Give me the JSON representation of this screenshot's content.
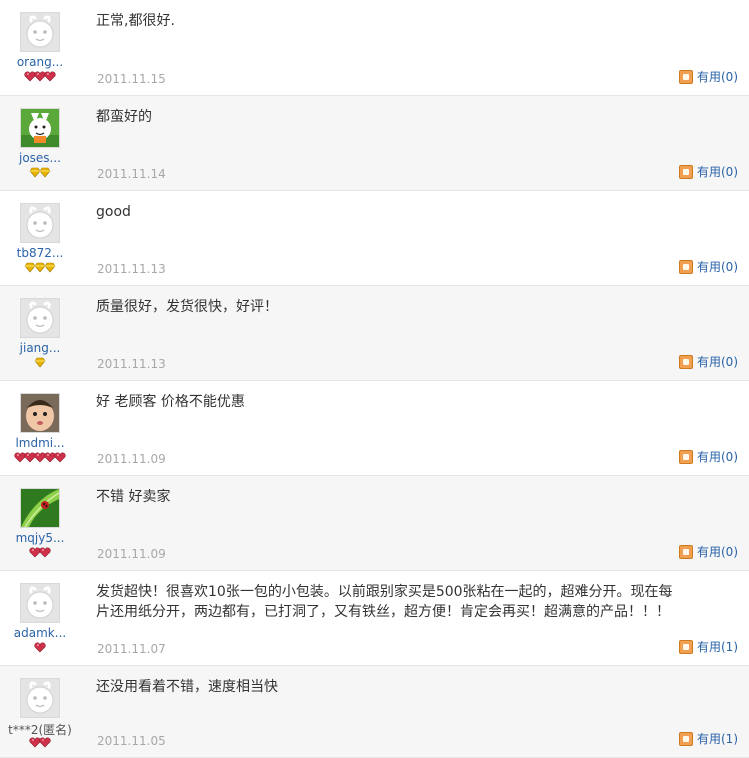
{
  "useful_prefix": "有用",
  "reviews": [
    {
      "user": "orang...",
      "rank": "heart",
      "rank_count": 3,
      "avatar": "default",
      "comment": "正常,都很好.",
      "date": "2011.11.15",
      "useful": "有用(0)"
    },
    {
      "user": "joses...",
      "rank": "diamond",
      "rank_count": 2,
      "avatar": "cartoon",
      "comment": "都蛮好的",
      "date": "2011.11.14",
      "useful": "有用(0)"
    },
    {
      "user": "tb872...",
      "rank": "diamond",
      "rank_count": 3,
      "avatar": "default",
      "comment": "good",
      "date": "2011.11.13",
      "useful": "有用(0)"
    },
    {
      "user": "jiang...",
      "rank": "diamond",
      "rank_count": 1,
      "avatar": "default",
      "comment": "质量很好，发货很快，好评！",
      "date": "2011.11.13",
      "useful": "有用(0)"
    },
    {
      "user": "lmdmi...",
      "rank": "heart",
      "rank_count": 5,
      "avatar": "baby",
      "comment": "好 老顾客 价格不能优惠",
      "date": "2011.11.09",
      "useful": "有用(0)"
    },
    {
      "user": "mqjy5...",
      "rank": "heart",
      "rank_count": 2,
      "avatar": "leaf",
      "comment": "不错 好卖家",
      "date": "2011.11.09",
      "useful": "有用(0)"
    },
    {
      "user": "adamk...",
      "rank": "heart",
      "rank_count": 1,
      "avatar": "default",
      "comment": "发货超快！很喜欢10张一包的小包装。以前跟别家买是500张粘在一起的，超难分开。现在每片还用纸分开，两边都有，已打洞了，又有铁丝，超方便！肯定会再买！超满意的产品！！！",
      "date": "2011.11.07",
      "useful": "有用(1)"
    },
    {
      "user": "t***2(匿名)",
      "rank": "heart",
      "rank_count": 2,
      "avatar": "default",
      "comment": "还没用看着不错，速度相当快",
      "date": "2011.11.05",
      "useful": "有用(1)"
    }
  ],
  "colors": {
    "heart": "#d0304a",
    "diamond": "#e8b400",
    "link": "#2a63a8",
    "date": "#a8a8a8"
  }
}
